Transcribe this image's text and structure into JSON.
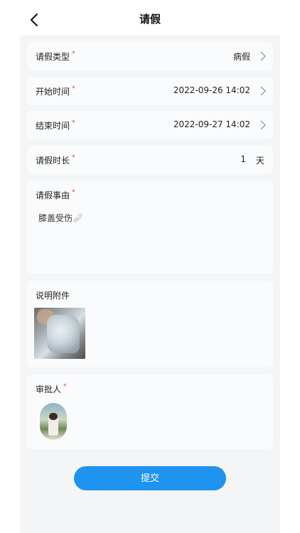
{
  "header": {
    "title": "请假"
  },
  "form": {
    "leave_type": {
      "label": "请假类型",
      "required_mark": "*",
      "value": "病假"
    },
    "start_time": {
      "label": "开始时间",
      "required_mark": "*",
      "value": "2022-09-26 14:02"
    },
    "end_time": {
      "label": "结束时间",
      "required_mark": "*",
      "value": "2022-09-27 14:02"
    },
    "duration": {
      "label": "请假时长",
      "required_mark": "*",
      "value": "1",
      "unit": "天"
    },
    "reason": {
      "label": "请假事由",
      "required_mark": "*",
      "value": "膝盖受伤🩹"
    },
    "attachment": {
      "label": "说明附件"
    },
    "approver": {
      "label": "审批人",
      "required_mark": "*"
    }
  },
  "actions": {
    "submit_label": "提交"
  },
  "colors": {
    "accent": "#1e93f0",
    "required": "#e53935",
    "background": "#f4f5f7"
  }
}
